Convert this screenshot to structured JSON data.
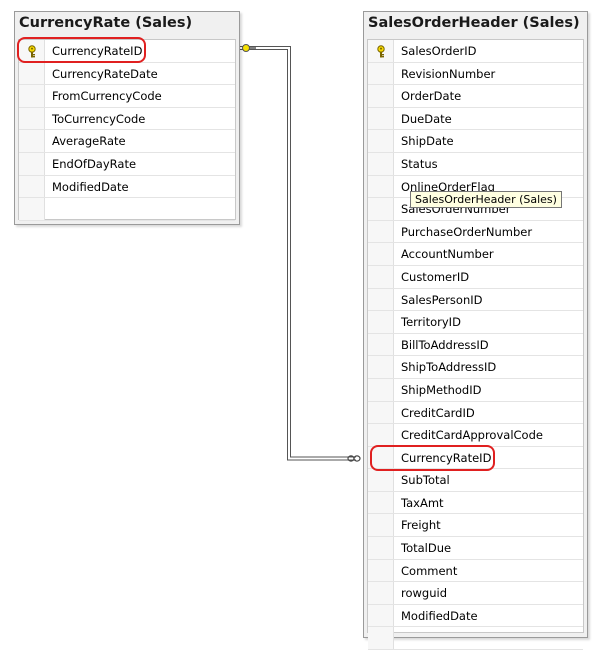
{
  "tables": {
    "currency_rate": {
      "title": "CurrencyRate (Sales)",
      "columns": [
        "CurrencyRateID",
        "CurrencyRateDate",
        "FromCurrencyCode",
        "ToCurrencyCode",
        "AverageRate",
        "EndOfDayRate",
        "ModifiedDate"
      ]
    },
    "sales_order_header": {
      "title": "SalesOrderHeader (Sales)",
      "columns": [
        "SalesOrderID",
        "RevisionNumber",
        "OrderDate",
        "DueDate",
        "ShipDate",
        "Status",
        "OnlineOrderFlag",
        "SalesOrderNumber",
        "PurchaseOrderNumber",
        "AccountNumber",
        "CustomerID",
        "SalesPersonID",
        "TerritoryID",
        "BillToAddressID",
        "ShipToAddressID",
        "ShipMethodID",
        "CreditCardID",
        "CreditCardApprovalCode",
        "CurrencyRateID",
        "SubTotal",
        "TaxAmt",
        "Freight",
        "TotalDue",
        "Comment",
        "rowguid",
        "ModifiedDate"
      ]
    }
  },
  "tooltip": "SalesOrderHeader (Sales)",
  "colors": {
    "highlight": "#e02020",
    "key_icon": "#d4b000",
    "relationship_line": "#555555"
  },
  "icons": {
    "primary_key": "key-icon",
    "relationship_one_end": "key-icon",
    "relationship_many_end": "infinity-icon"
  }
}
